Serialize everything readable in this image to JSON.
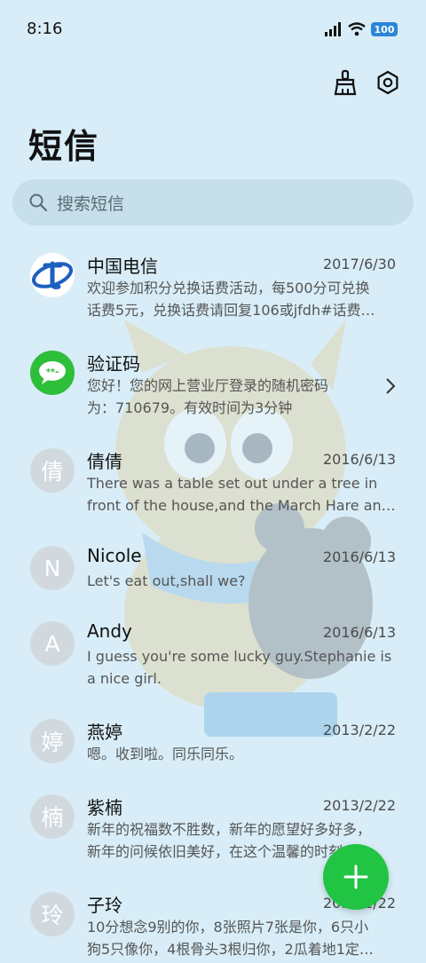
{
  "status_bar": {
    "time": "8:16",
    "battery": "100"
  },
  "page_title": "短信",
  "search": {
    "placeholder": "搜索短信"
  },
  "colors": {
    "accent_green": "#22c443",
    "background": "#d8edf7",
    "search_bg": "#c6dfea"
  },
  "icons": {
    "clean": "broom-icon",
    "settings": "gear-icon",
    "search": "search-icon",
    "compose": "plus-icon"
  },
  "conversations": [
    {
      "name": "中国电信",
      "date": "2017/6/30",
      "avatar": "",
      "preview": [
        "欢迎参加积分兑换话费活动，每500分可兑换",
        "话费5元，兑换话费请回复106或jfdh#话费…"
      ]
    },
    {
      "name": "验证码",
      "date": "",
      "avatar": "",
      "preview": [
        "您好！您的网上营业厅登录的随机密码",
        "为：710679。有效时间为3分钟"
      ]
    },
    {
      "name": "倩倩",
      "date": "2016/6/13",
      "avatar": "倩",
      "preview": [
        "There was a table set out under a tree in",
        "front of the house,and the March Hare an…"
      ]
    },
    {
      "name": "Nicole",
      "date": "2016/6/13",
      "avatar": "N",
      "preview": [
        "Let's eat out,shall we?"
      ]
    },
    {
      "name": "Andy",
      "date": "2016/6/13",
      "avatar": "A",
      "preview": [
        "I guess you're some lucky guy.Stephanie is",
        "a nice girl."
      ]
    },
    {
      "name": "燕婷",
      "date": "2013/2/22",
      "avatar": "婷",
      "preview": [
        "嗯。收到啦。同乐同乐。"
      ]
    },
    {
      "name": "紫楠",
      "date": "2013/2/22",
      "avatar": "楠",
      "preview": [
        "新年的祝福数不胜数，新年的愿望好多好多，",
        "新年的问候依旧美好，在这个温馨的时刻，…"
      ]
    },
    {
      "name": "子玲",
      "date": "2013/2/22",
      "avatar": "玲",
      "preview": [
        "10分想念9别的你，8张照片7张是你，6只小",
        "狗5只像你，4根骨头3根归你，2瓜着地1定…"
      ]
    }
  ]
}
